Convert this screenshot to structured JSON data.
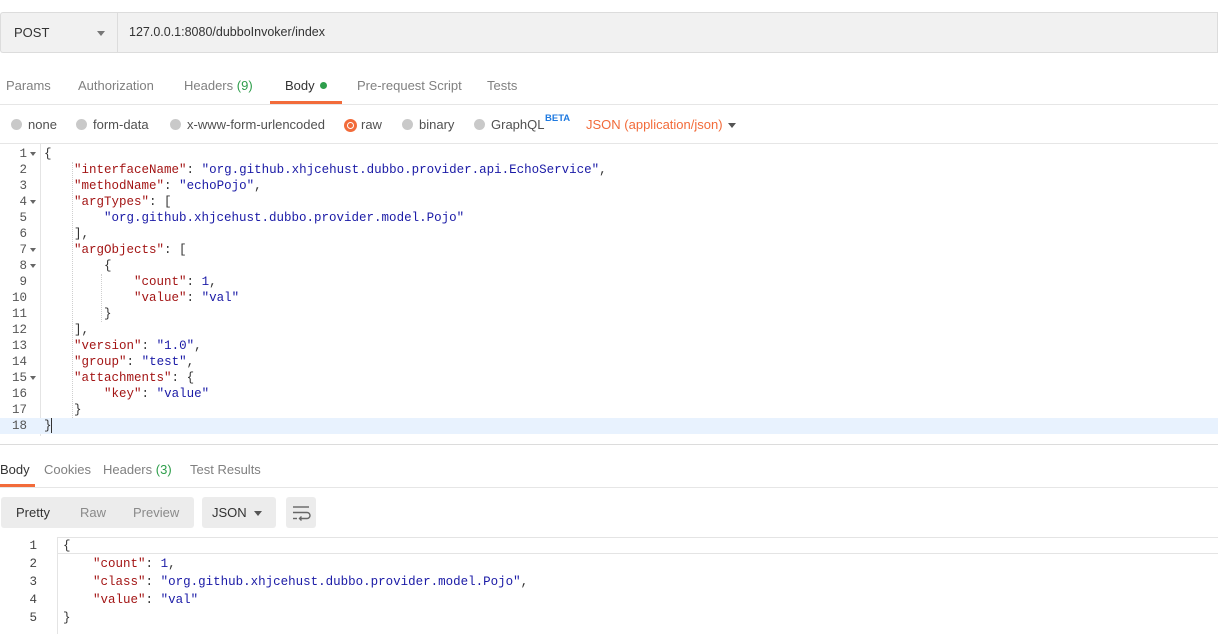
{
  "request": {
    "method": "POST",
    "url": "127.0.0.1:8080/dubboInvoker/index"
  },
  "request_tabs": {
    "params": "Params",
    "authorization": "Authorization",
    "headers": "Headers",
    "headers_count": "(9)",
    "body": "Body",
    "prerequest": "Pre-request Script",
    "tests": "Tests"
  },
  "body_modes": {
    "none": "none",
    "form_data": "form-data",
    "urlencoded": "x-www-form-urlencoded",
    "raw": "raw",
    "binary": "binary",
    "graphql": "GraphQL",
    "graphql_badge": "BETA",
    "content_type": "JSON (application/json)",
    "selected": "raw"
  },
  "request_body_lines": [
    "{",
    "    \"interfaceName\": \"org.github.xhjcehust.dubbo.provider.api.EchoService\",",
    "    \"methodName\": \"echoPojo\",",
    "    \"argTypes\": [",
    "        \"org.github.xhjcehust.dubbo.provider.model.Pojo\"",
    "    ],",
    "    \"argObjects\": [",
    "        {",
    "            \"count\": 1,",
    "            \"value\": \"val\"",
    "        }",
    "    ],",
    "    \"version\": \"1.0\",",
    "    \"group\": \"test\",",
    "    \"attachments\": {",
    "        \"key\": \"value\"",
    "    }",
    "}"
  ],
  "request_line_numbers": [
    "1",
    "2",
    "3",
    "4",
    "5",
    "6",
    "7",
    "8",
    "9",
    "10",
    "11",
    "12",
    "13",
    "14",
    "15",
    "16",
    "17",
    "18"
  ],
  "response_tabs": {
    "body": "Body",
    "cookies": "Cookies",
    "headers": "Headers",
    "headers_count": "(3)",
    "test_results": "Test Results"
  },
  "response_view": {
    "pretty": "Pretty",
    "raw": "Raw",
    "preview": "Preview",
    "format": "JSON",
    "wrap_icon": "wrap-lines-icon"
  },
  "response_body_lines": [
    "{",
    "    \"count\": 1,",
    "    \"class\": \"org.github.xhjcehust.dubbo.provider.model.Pojo\",",
    "    \"value\": \"val\"",
    "}"
  ],
  "response_line_numbers": [
    "1",
    "2",
    "3",
    "4",
    "5"
  ],
  "colors": {
    "accent": "#f26b3a",
    "green": "#2e9e4b",
    "json_key": "#a31515",
    "json_string": "#1a1aa6",
    "beta": "#1f7ae0"
  }
}
